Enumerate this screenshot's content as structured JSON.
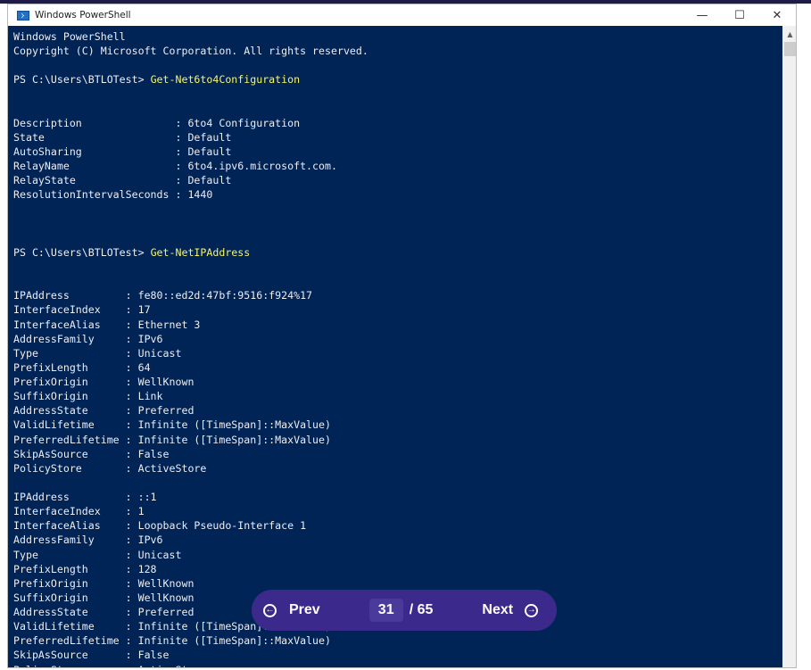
{
  "window": {
    "title": "Windows PowerShell",
    "controls": {
      "minimize": "—",
      "maximize": "☐",
      "close": "✕"
    }
  },
  "console": {
    "lines": [
      {
        "text": "Windows PowerShell"
      },
      {
        "text": "Copyright (C) Microsoft Corporation. All rights reserved."
      },
      {
        "text": ""
      },
      {
        "prompt": "PS C:\\Users\\BTLOTest> ",
        "command": "Get-Net6to4Configuration"
      },
      {
        "text": ""
      },
      {
        "text": ""
      },
      {
        "text": "Description               : 6to4 Configuration"
      },
      {
        "text": "State                     : Default"
      },
      {
        "text": "AutoSharing               : Default"
      },
      {
        "text": "RelayName                 : 6to4.ipv6.microsoft.com."
      },
      {
        "text": "RelayState                : Default"
      },
      {
        "text": "ResolutionIntervalSeconds : 1440"
      },
      {
        "text": ""
      },
      {
        "text": ""
      },
      {
        "text": ""
      },
      {
        "prompt": "PS C:\\Users\\BTLOTest> ",
        "command": "Get-NetIPAddress"
      },
      {
        "text": ""
      },
      {
        "text": ""
      },
      {
        "text": "IPAddress         : fe80::ed2d:47bf:9516:f924%17"
      },
      {
        "text": "InterfaceIndex    : 17"
      },
      {
        "text": "InterfaceAlias    : Ethernet 3"
      },
      {
        "text": "AddressFamily     : IPv6"
      },
      {
        "text": "Type              : Unicast"
      },
      {
        "text": "PrefixLength      : 64"
      },
      {
        "text": "PrefixOrigin      : WellKnown"
      },
      {
        "text": "SuffixOrigin      : Link"
      },
      {
        "text": "AddressState      : Preferred"
      },
      {
        "text": "ValidLifetime     : Infinite ([TimeSpan]::MaxValue)"
      },
      {
        "text": "PreferredLifetime : Infinite ([TimeSpan]::MaxValue)"
      },
      {
        "text": "SkipAsSource      : False"
      },
      {
        "text": "PolicyStore       : ActiveStore"
      },
      {
        "text": ""
      },
      {
        "text": "IPAddress         : ::1"
      },
      {
        "text": "InterfaceIndex    : 1"
      },
      {
        "text": "InterfaceAlias    : Loopback Pseudo-Interface 1"
      },
      {
        "text": "AddressFamily     : IPv6"
      },
      {
        "text": "Type              : Unicast"
      },
      {
        "text": "PrefixLength      : 128"
      },
      {
        "text": "PrefixOrigin      : WellKnown"
      },
      {
        "text": "SuffixOrigin      : WellKnown"
      },
      {
        "text": "AddressState      : Preferred"
      },
      {
        "text": "ValidLifetime     : Infinite ([TimeSpan]::MaxValue)"
      },
      {
        "text": "PreferredLifetime : Infinite ([TimeSpan]::MaxValue)"
      },
      {
        "text": "SkipAsSource      : False"
      },
      {
        "text": "PolicyStore       : ActiveStore"
      }
    ]
  },
  "pager": {
    "prev_label": "Prev",
    "next_label": "Next",
    "current_page": "31",
    "total": "/ 65"
  },
  "colors": {
    "console_bg": "#012456",
    "console_text": "#eeedf0",
    "command_text": "#f5f569",
    "pager_bg": "#3b2a8c"
  }
}
